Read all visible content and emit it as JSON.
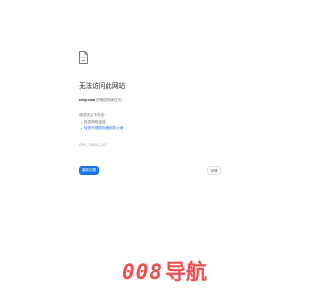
{
  "error_page": {
    "icon": "sad-page-icon",
    "title": "无法访问此网站",
    "host": "rolqi.com",
    "message_suffix": " 的响应时间过长。",
    "try_heading": "请试试以下办法：",
    "suggestions": [
      "检查网络连接",
      "检查代理服务器和防火墙"
    ],
    "error_code": "ERR_TIMED_OUT",
    "reload_label": "重新加载",
    "details_label": "详情"
  },
  "watermark": {
    "digits": "008",
    "text": "导航",
    "color": "#f04e4e"
  },
  "colors": {
    "accent": "#1a73e8",
    "text_primary": "#202124",
    "text_secondary": "#5f6368"
  }
}
